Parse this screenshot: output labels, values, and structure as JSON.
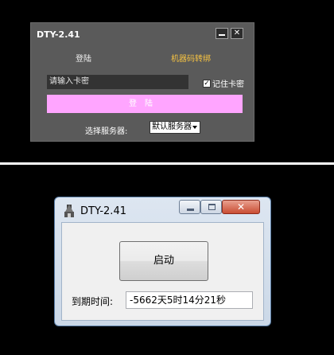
{
  "top_window": {
    "title": "DTY-2.41",
    "minimize_glyph": "—",
    "close_glyph": "✕",
    "tabs": {
      "login": "登陆",
      "machine_transfer": "机器码转绑"
    },
    "cardkey_input": {
      "value": "请输入卡密"
    },
    "remember_checkbox": {
      "checked": true,
      "check_glyph": "✓",
      "label": "记住卡密"
    },
    "login_button": "登陆",
    "server": {
      "label": "选择服务器:",
      "selected": "默认服务器"
    },
    "colors": {
      "background": "#5a5a5a",
      "login_button": "#ffa5ff",
      "active_tab": "#f5c242"
    }
  },
  "bottom_window": {
    "title": "DTY-2.41",
    "close_glyph": "✕",
    "start_button": "启动",
    "expiry": {
      "label": "到期时间:",
      "value": "-5662天5时14分21秒"
    }
  },
  "icons": [
    "minimize-icon",
    "close-icon",
    "checkbox-icon",
    "dropdown-arrow-icon",
    "app-icon",
    "maximize-icon"
  ]
}
